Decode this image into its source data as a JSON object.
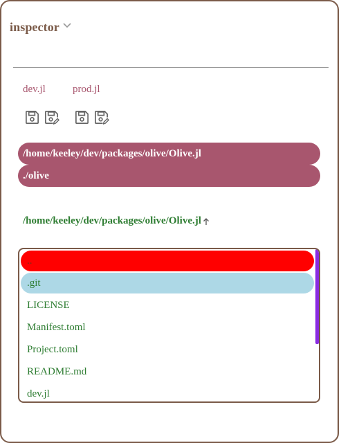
{
  "panel": {
    "title": "inspector",
    "collapse_icon": "chevron-down-icon"
  },
  "files": {
    "tabs": [
      {
        "label": "dev.jl",
        "icons": [
          "save-icon",
          "save-as-icon"
        ]
      },
      {
        "label": "prod.jl",
        "icons": [
          "save-icon",
          "save-as-icon"
        ]
      }
    ]
  },
  "paths": {
    "project_path": "/home/keeley/dev/packages/olive/Olive.jl",
    "olive_path": "./olive"
  },
  "browser": {
    "current_dir": "/home/keeley/dev/packages/olive/Olive.jl",
    "up_icon": "arrow-up-icon",
    "items": [
      {
        "name": ".."
      },
      {
        "name": ".git"
      },
      {
        "name": "LICENSE"
      },
      {
        "name": "Manifest.toml"
      },
      {
        "name": "Project.toml"
      },
      {
        "name": "README.md"
      },
      {
        "name": "dev.jl"
      }
    ]
  },
  "colors": {
    "accent": "#a8566e",
    "border": "#7a5a48",
    "file_text": "#2e7d32",
    "parent_highlight": "#ff0000",
    "selected_highlight": "#add8e6",
    "scrollbar": "#8a2be2"
  }
}
